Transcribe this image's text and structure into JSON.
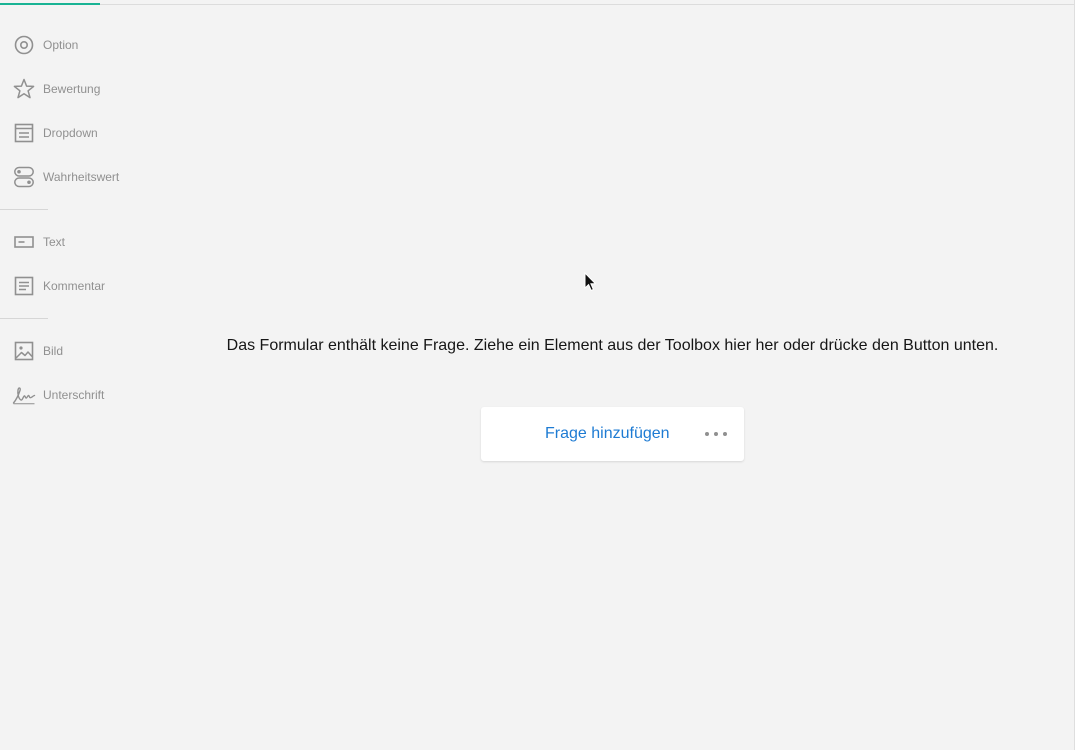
{
  "toolbox": {
    "items": [
      {
        "label": "Option",
        "icon": "radio-icon"
      },
      {
        "label": "Bewertung",
        "icon": "star-icon"
      },
      {
        "label": "Dropdown",
        "icon": "dropdown-icon"
      },
      {
        "label": "Wahrheitswert",
        "icon": "boolean-toggle-icon"
      },
      {
        "label": "Text",
        "icon": "text-input-icon"
      },
      {
        "label": "Kommentar",
        "icon": "comment-icon"
      },
      {
        "label": "Bild",
        "icon": "image-icon"
      },
      {
        "label": "Unterschrift",
        "icon": "signature-icon"
      }
    ]
  },
  "designer": {
    "empty_message": "Das Formular enthält keine Frage. Ziehe ein Element aus der Toolbox hier her oder drücke den Button unten.",
    "add_question_label": "Frage hinzufügen",
    "more_icon": "more-dots-icon"
  },
  "colors": {
    "accent": "#1e7bd3",
    "background": "#f3f3f3",
    "icon_gray": "#909090"
  }
}
